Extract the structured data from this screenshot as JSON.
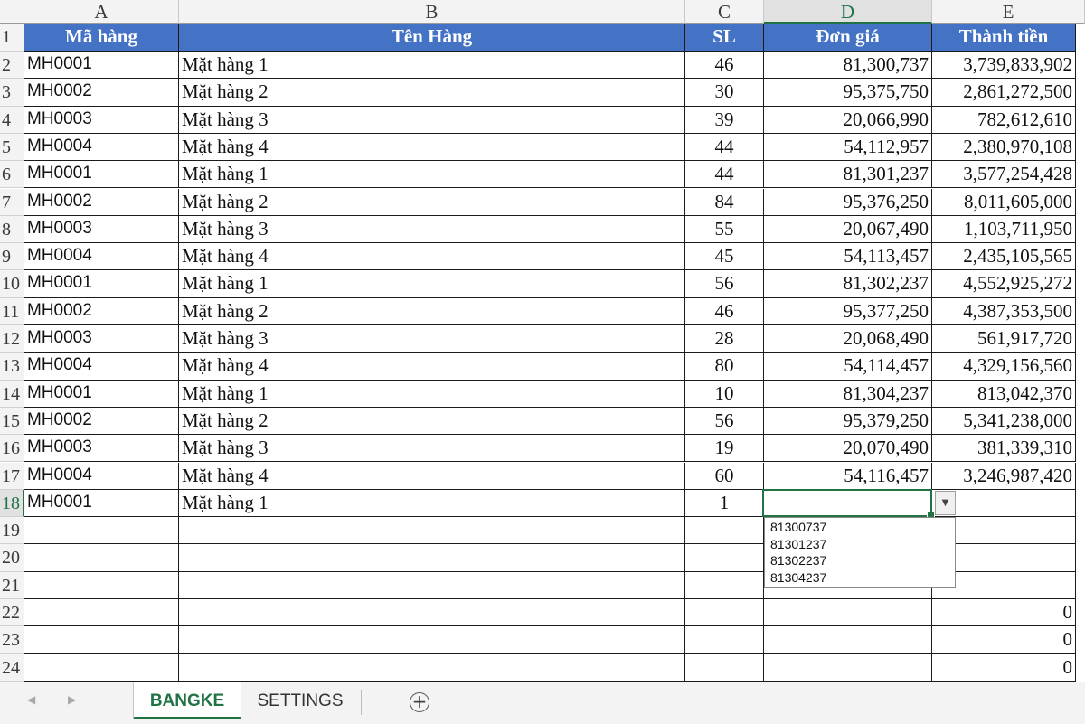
{
  "columns": [
    "A",
    "B",
    "C",
    "D",
    "E"
  ],
  "selected_column": "D",
  "headers": {
    "a": "Mã hàng",
    "b": "Tên Hàng",
    "c": "SL",
    "d": "Đơn giá",
    "e": "Thành tiền"
  },
  "rows": [
    {
      "row": "2",
      "code": "MH0001",
      "name": "Mặt hàng 1",
      "qty": "46",
      "price": "81,300,737",
      "total": "3,739,833,902"
    },
    {
      "row": "3",
      "code": "MH0002",
      "name": "Mặt hàng 2",
      "qty": "30",
      "price": "95,375,750",
      "total": "2,861,272,500"
    },
    {
      "row": "4",
      "code": "MH0003",
      "name": "Mặt hàng 3",
      "qty": "39",
      "price": "20,066,990",
      "total": "782,612,610"
    },
    {
      "row": "5",
      "code": "MH0004",
      "name": "Mặt hàng 4",
      "qty": "44",
      "price": "54,112,957",
      "total": "2,380,970,108"
    },
    {
      "row": "6",
      "code": "MH0001",
      "name": "Mặt hàng 1",
      "qty": "44",
      "price": "81,301,237",
      "total": "3,577,254,428"
    },
    {
      "row": "7",
      "code": "MH0002",
      "name": "Mặt hàng 2",
      "qty": "84",
      "price": "95,376,250",
      "total": "8,011,605,000"
    },
    {
      "row": "8",
      "code": "MH0003",
      "name": "Mặt hàng 3",
      "qty": "55",
      "price": "20,067,490",
      "total": "1,103,711,950"
    },
    {
      "row": "9",
      "code": "MH0004",
      "name": "Mặt hàng 4",
      "qty": "45",
      "price": "54,113,457",
      "total": "2,435,105,565"
    },
    {
      "row": "10",
      "code": "MH0001",
      "name": "Mặt hàng 1",
      "qty": "56",
      "price": "81,302,237",
      "total": "4,552,925,272"
    },
    {
      "row": "11",
      "code": "MH0002",
      "name": "Mặt hàng 2",
      "qty": "46",
      "price": "95,377,250",
      "total": "4,387,353,500"
    },
    {
      "row": "12",
      "code": "MH0003",
      "name": "Mặt hàng 3",
      "qty": "28",
      "price": "20,068,490",
      "total": "561,917,720"
    },
    {
      "row": "13",
      "code": "MH0004",
      "name": "Mặt hàng 4",
      "qty": "80",
      "price": "54,114,457",
      "total": "4,329,156,560"
    },
    {
      "row": "14",
      "code": "MH0001",
      "name": "Mặt hàng 1",
      "qty": "10",
      "price": "81,304,237",
      "total": "813,042,370"
    },
    {
      "row": "15",
      "code": "MH0002",
      "name": "Mặt hàng 2",
      "qty": "56",
      "price": "95,379,250",
      "total": "5,341,238,000"
    },
    {
      "row": "16",
      "code": "MH0003",
      "name": "Mặt hàng 3",
      "qty": "19",
      "price": "20,070,490",
      "total": "381,339,310"
    },
    {
      "row": "17",
      "code": "MH0004",
      "name": "Mặt hàng 4",
      "qty": "60",
      "price": "54,116,457",
      "total": "3,246,987,420"
    },
    {
      "row": "18",
      "code": "MH0001",
      "name": "Mặt hàng 1",
      "qty": "1",
      "price": "",
      "total": ""
    },
    {
      "row": "19",
      "code": "",
      "name": "",
      "qty": "",
      "price": "",
      "total": ""
    },
    {
      "row": "20",
      "code": "",
      "name": "",
      "qty": "",
      "price": "",
      "total": ""
    },
    {
      "row": "21",
      "code": "",
      "name": "",
      "qty": "",
      "price": "",
      "total": ""
    },
    {
      "row": "22",
      "code": "",
      "name": "",
      "qty": "",
      "price": "",
      "total": "0"
    },
    {
      "row": "23",
      "code": "",
      "name": "",
      "qty": "",
      "price": "",
      "total": "0"
    },
    {
      "row": "24",
      "code": "",
      "name": "",
      "qty": "",
      "price": "",
      "total": "0"
    }
  ],
  "active_row": "18",
  "dropdown": {
    "button_icon": "dropdown-arrow-icon",
    "options": [
      "81300737",
      "81301237",
      "81302237",
      "81304237"
    ]
  },
  "sheets": {
    "tabs": [
      "BANGKE",
      "SETTINGS"
    ],
    "active": "BANGKE",
    "add_icon": "plus-circle-icon"
  },
  "colors": {
    "header_fill": "#4472c4",
    "accent": "#217346"
  }
}
